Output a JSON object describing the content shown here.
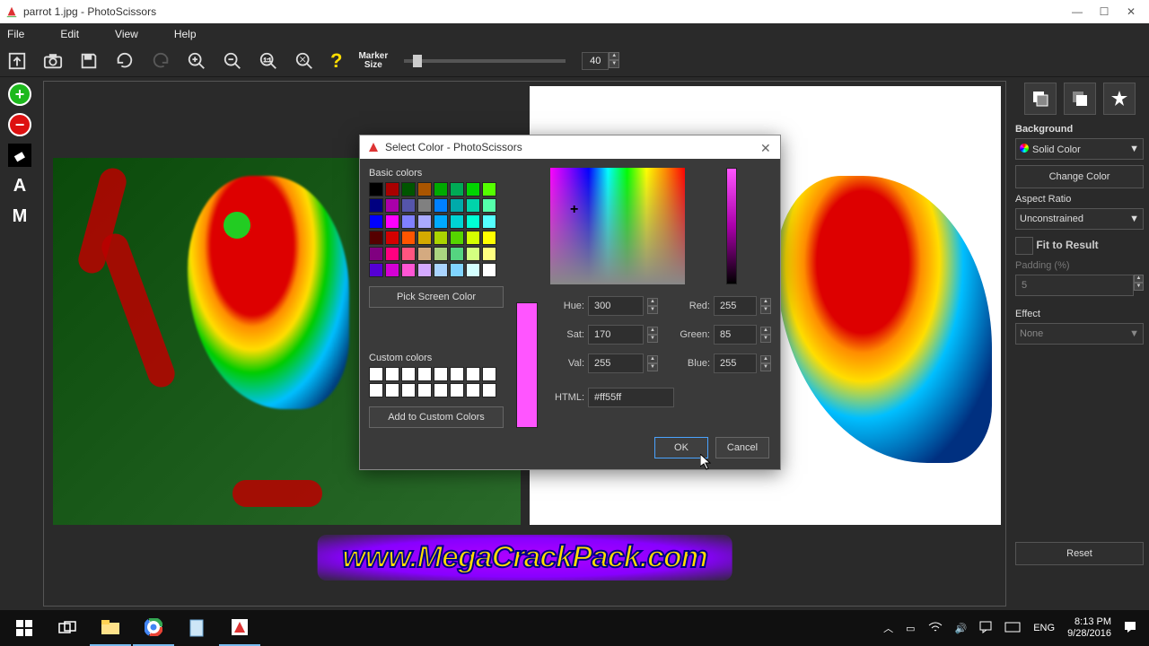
{
  "window": {
    "title": "parrot 1.jpg - PhotoScissors"
  },
  "menu": {
    "file": "File",
    "edit": "Edit",
    "view": "View",
    "help": "Help"
  },
  "toolbar": {
    "marker_label1": "Marker",
    "marker_label2": "Size",
    "marker_value": "40"
  },
  "left_tools": {
    "add": "+",
    "remove": "−",
    "text": "A",
    "mask": "M"
  },
  "watermark": "www.MegaCrackPack.com",
  "right_panel": {
    "background_label": "Background",
    "bg_mode": "Solid Color",
    "change_color": "Change Color",
    "aspect_label": "Aspect Ratio",
    "aspect_value": "Unconstrained",
    "fit_label": "Fit to Result",
    "padding_label": "Padding (%)",
    "padding_value": "5",
    "effect_label": "Effect",
    "effect_value": "None",
    "reset": "Reset"
  },
  "dialog": {
    "title": "Select Color - PhotoScissors",
    "basic_colors": "Basic colors",
    "pick_screen": "Pick Screen Color",
    "custom_colors": "Custom colors",
    "add_custom": "Add to Custom Colors",
    "hue_label": "Hue:",
    "hue": "300",
    "sat_label": "Sat:",
    "sat": "170",
    "val_label": "Val:",
    "val": "255",
    "red_label": "Red:",
    "red": "255",
    "green_label": "Green:",
    "green": "85",
    "blue_label": "Blue:",
    "blue": "255",
    "html_label": "HTML:",
    "html": "#ff55ff",
    "ok": "OK",
    "cancel": "Cancel",
    "preview_color": "#ff55ff",
    "basic_swatches": [
      "#000000",
      "#aa0000",
      "#005500",
      "#aa5500",
      "#00aa00",
      "#00aa55",
      "#00d400",
      "#55ff00",
      "#000080",
      "#aa00aa",
      "#5555aa",
      "#808080",
      "#0080ff",
      "#00aaaa",
      "#00d4aa",
      "#55ffaa",
      "#0000ff",
      "#ff00ff",
      "#8080ff",
      "#aaaaff",
      "#00aaff",
      "#00d4d4",
      "#00ffd4",
      "#55ffff",
      "#550000",
      "#d40000",
      "#ff5500",
      "#d4aa00",
      "#aad400",
      "#55d400",
      "#d4ff00",
      "#ffff00",
      "#800080",
      "#ff0080",
      "#ff5580",
      "#d4aa80",
      "#aad480",
      "#55d480",
      "#d4ff80",
      "#ffff80",
      "#5500d4",
      "#d400d4",
      "#ff55d4",
      "#d4aaff",
      "#aad4ff",
      "#80d4ff",
      "#d4ffff",
      "#ffffff"
    ]
  },
  "taskbar": {
    "lang": "ENG",
    "time": "8:13 PM",
    "date": "9/28/2016"
  }
}
